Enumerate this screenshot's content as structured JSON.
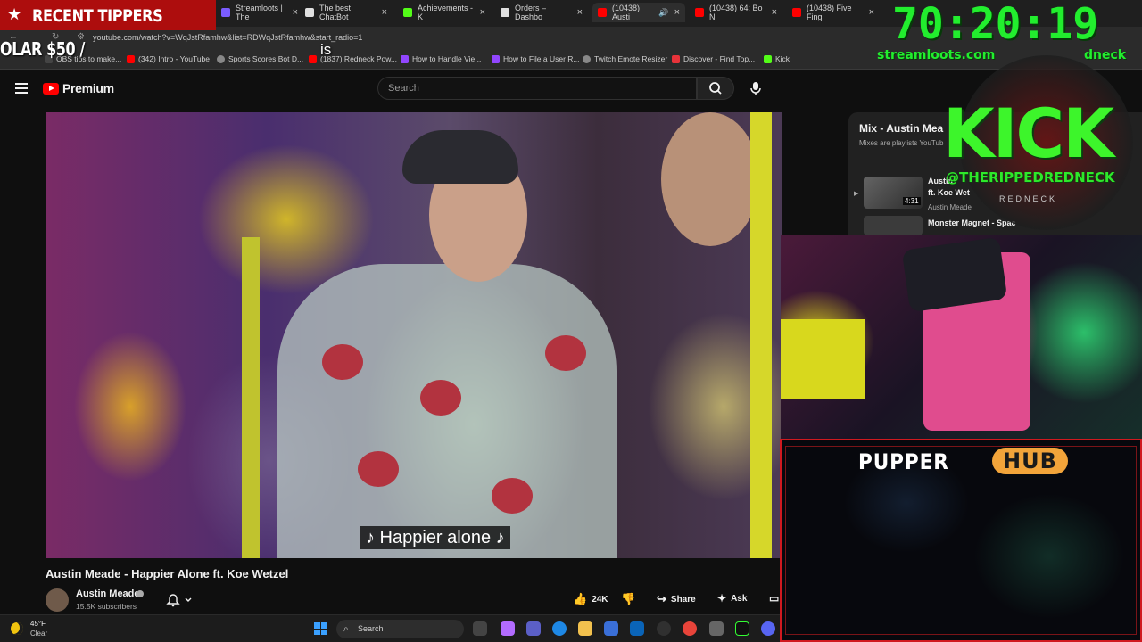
{
  "browser": {
    "tabs": [
      {
        "label": "Streamloots | The",
        "color": "#7a5cff"
      },
      {
        "label": "The best ChatBot",
        "color": "#e0e0e0"
      },
      {
        "label": "Achievements - K",
        "color": "#53fc18"
      },
      {
        "label": "Orders – Dashbo",
        "color": "#e0e0e0"
      },
      {
        "label": "(10438) Austi",
        "color": "#ff0000"
      },
      {
        "label": "(10438) 64: Bo N",
        "color": "#ff0000"
      },
      {
        "label": "(10438) Five Fing",
        "color": "#ff0000"
      }
    ],
    "url": "youtube.com/watch?v=WqJstRfamhw&list=RDWqJstRfamhw&start_radio=1",
    "bookmarks": [
      {
        "label": "OBS tips to make...",
        "color": "#444"
      },
      {
        "label": "(342) Intro - YouTube",
        "color": "#ff0000"
      },
      {
        "label": "Sports Scores Bot D...",
        "color": "#888"
      },
      {
        "label": "(1837) Redneck Pow...",
        "color": "#ff0000"
      },
      {
        "label": "How to Handle Vie...",
        "color": "#9146ff"
      },
      {
        "label": "How to File a User R...",
        "color": "#9146ff"
      },
      {
        "label": "Twitch Emote Resizer",
        "color": "#888"
      },
      {
        "label": "Discover - Find Top...",
        "color": "#e8333a"
      },
      {
        "label": "Kick",
        "color": "#53fc18"
      }
    ]
  },
  "youtube": {
    "logo_label": "Premium",
    "search_placeholder": "Search",
    "caption": "♪ Happier alone ♪",
    "video_title": "Austin Meade - Happier Alone ft. Koe Wetzel",
    "channel_name": "Austin Meade",
    "subscribers": "15.5K subscribers",
    "likes": "24K",
    "share_label": "Share",
    "ask_label": "Ask",
    "mix": {
      "title": "Mix - Austin Mea",
      "subtitle": "Mixes are playlists YouTub",
      "item_title_line1": "Austin",
      "item_title_line2": "ft. Koe Wet",
      "item_channel": "Austin Meade",
      "item_duration": "4:31",
      "next_item_title": "Monster Magnet - Spac"
    }
  },
  "overlay": {
    "tippers_title": "RECENT TIPPERS",
    "tipper_entry": "OLAR $50 /",
    "stray_text": "is",
    "timer": "70:20:19",
    "site_left": "streamloots.com",
    "site_right": "dneck",
    "kick_text": "KICK",
    "kick_handle": "@THERIPPEDREDNECK",
    "badge_banner": "REDNECK",
    "pupper_label": "PUPPER",
    "hub_label": "HUB"
  },
  "taskbar": {
    "temperature": "45°F",
    "weather": "Clear",
    "search_label": "Search"
  }
}
